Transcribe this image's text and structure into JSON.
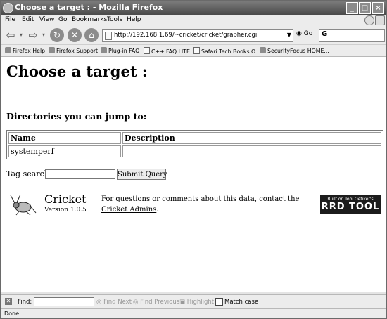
{
  "window": {
    "title": "Choose a target : - Mozilla Firefox"
  },
  "menu": [
    "File",
    "Edit",
    "View",
    "Go",
    "Bookmarks",
    "Tools",
    "Help"
  ],
  "nav": {
    "url": "http://192.168.1.69/~cricket/cricket/grapher.cgi",
    "go_label": "Go",
    "search_value": "G"
  },
  "bookmarks": [
    "Firefox Help",
    "Firefox Support",
    "Plug-in FAQ",
    "C++ FAQ LITE",
    "Safari Tech Books O...",
    "SecurityFocus HOME..."
  ],
  "page": {
    "title": "Choose a target :",
    "subtitle": "Directories you can jump to:",
    "table": {
      "headers": [
        "Name",
        "Description"
      ],
      "rows": [
        [
          "systemperf",
          ""
        ]
      ]
    },
    "tag_search_label": "Tag search:",
    "tag_search_value": "",
    "submit_label": "Submit Query",
    "cricket_name": "Cricket",
    "cricket_version": "Version 1.0.5",
    "contact_text": "For questions or comments about this data, contact ",
    "contact_link": "the Cricket Admins",
    "contact_end": ".",
    "rrd_line1": "Built on Tobi Oetiker's",
    "rrd_line2": "RRD TOOL"
  },
  "findbar": {
    "label": "Find:",
    "value": "",
    "find_next": "Find Next",
    "find_previous": "Find Previous",
    "highlight": "Highlight",
    "match_case": "Match case"
  },
  "status": {
    "text": "Done"
  }
}
